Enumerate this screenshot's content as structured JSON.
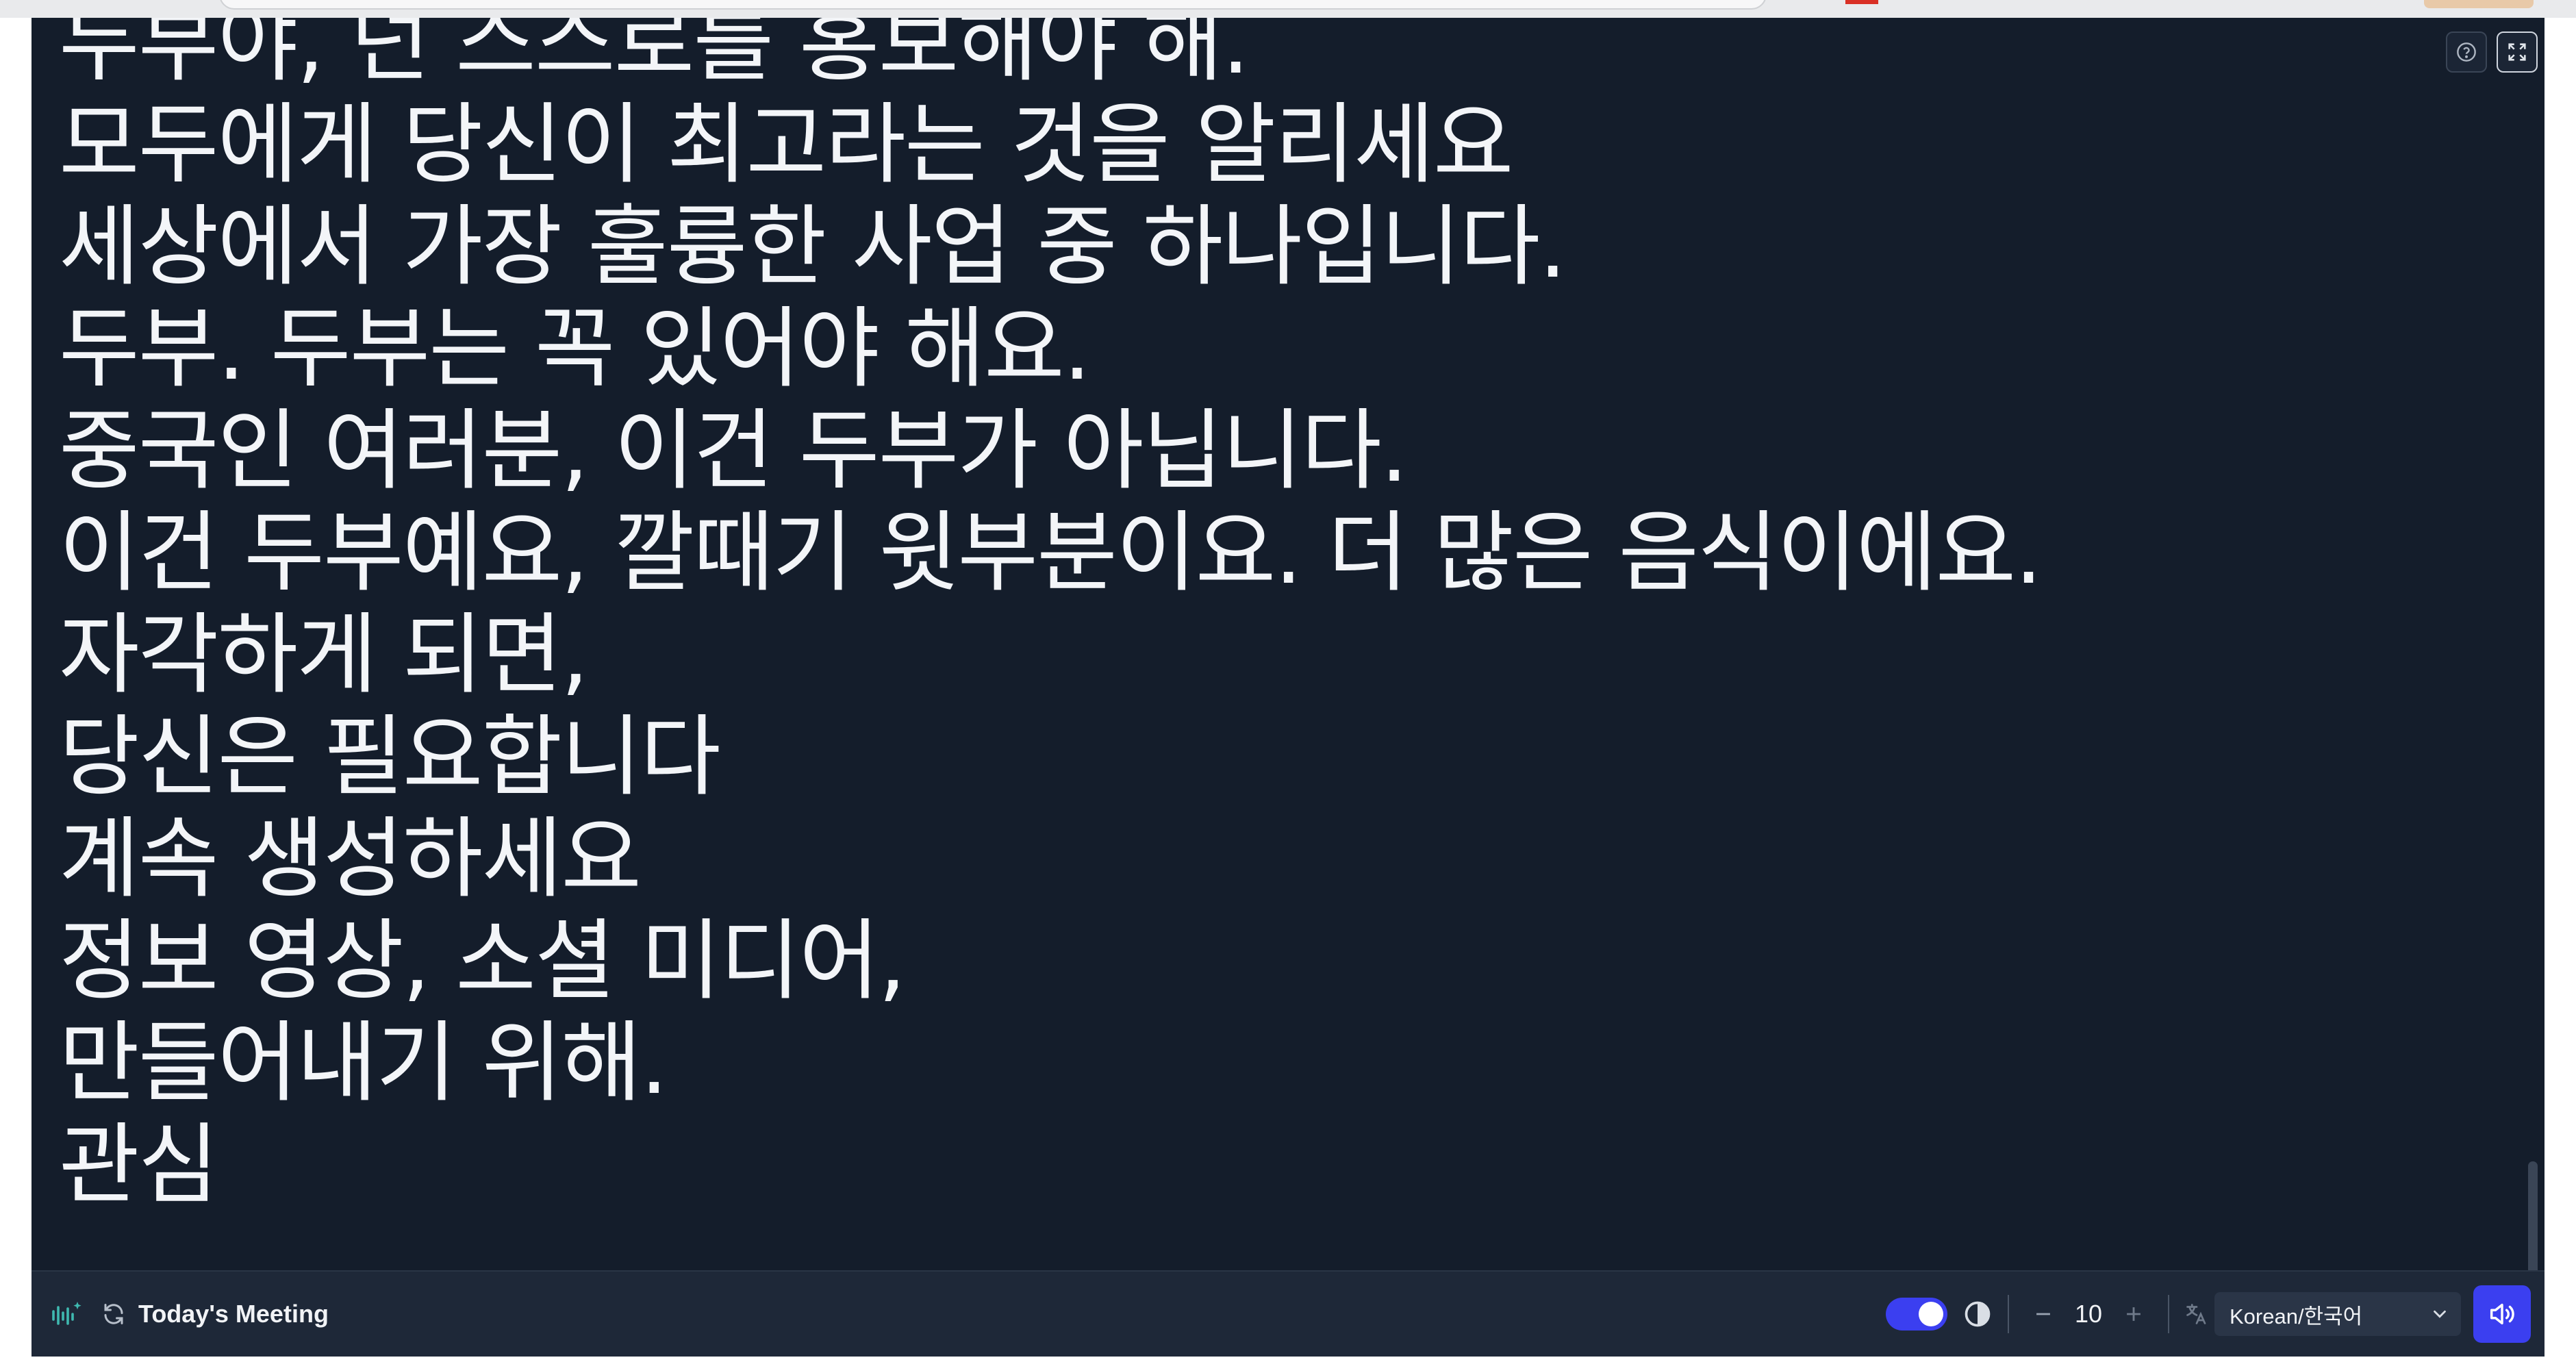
{
  "captions": {
    "lines": [
      "두부야, 넌 스스로를 홍보해야 해.",
      "모두에게 당신이 최고라는 것을 알리세요",
      "세상에서 가장 훌륭한 사업 중 하나입니다.",
      "두부. 두부는 꼭 있어야 해요.",
      "중국인 여러분, 이건 두부가 아닙니다.",
      "이건 두부예요, 깔때기 윗부분이요. 더 많은 음식이에요.",
      "자각하게 되면,",
      "당신은 필요합니다",
      "계속 생성하세요",
      "정보 영상, 소셜 미디어,",
      "만들어내기 위해.",
      "관심"
    ]
  },
  "toolbar": {
    "meeting_title": "Today's Meeting",
    "font_size": "10",
    "language": "Korean/한국어",
    "toggle_on": true
  },
  "icons": {
    "logo": "waveform-sparkle-icon",
    "refresh": "refresh-icon",
    "contrast": "contrast-icon",
    "minus": "minus-icon",
    "plus": "plus-icon",
    "translate": "translate-icon",
    "chevron": "chevron-down-icon",
    "speaker": "speaker-icon",
    "help": "help-icon",
    "fullscreen": "fullscreen-icon"
  },
  "colors": {
    "panel_bg": "#141d2b",
    "toolbar_bg": "#1e2838",
    "accent": "#3b3ff0",
    "logo_teal": "#3fb9b0"
  }
}
